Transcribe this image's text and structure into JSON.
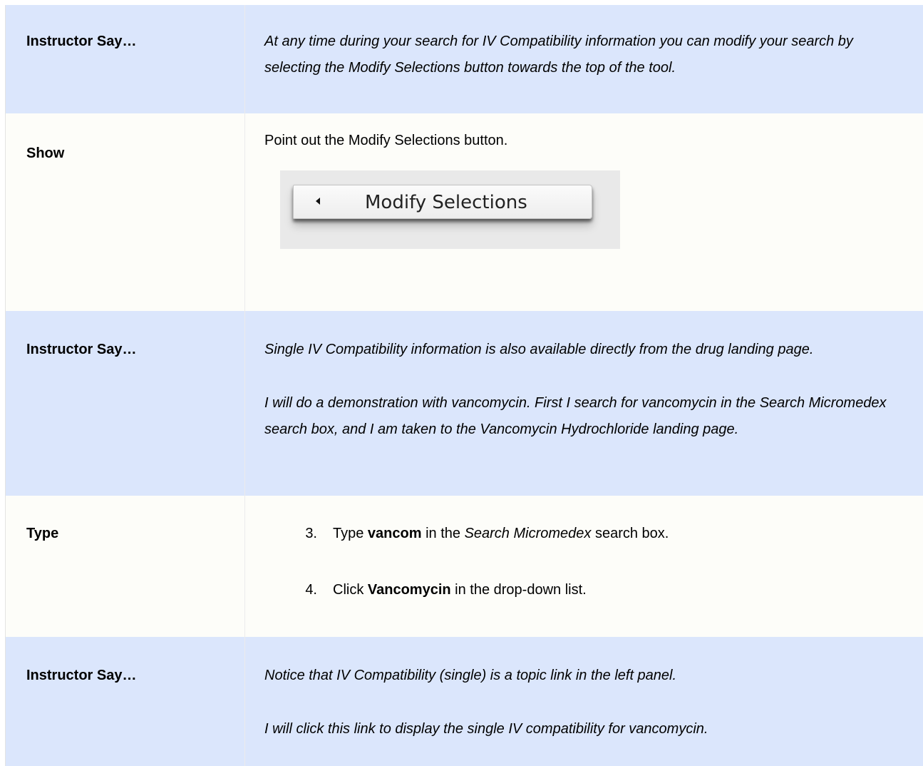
{
  "rows": [
    {
      "label": "Instructor Say…",
      "text": "At any time during your search for IV Compatibility information you can modify your search by selecting the Modify Selections button towards the top of the tool."
    },
    {
      "label": "Show",
      "text": "Point out the Modify Selections button.",
      "button_label": "Modify Selections"
    },
    {
      "label": "Instructor Say…",
      "para1": "Single IV Compatibility information is also available directly from the drug landing page.",
      "para2": "I will do a demonstration with vancomycin. First I search for vancomycin in the Search Micromedex search box, and I am taken to the Vancomycin Hydrochloride landing page."
    },
    {
      "label": "Type",
      "steps": [
        {
          "num": "3.",
          "pre": "Type ",
          "bold": "vancom",
          "mid": " in the ",
          "italic": "Search Micromedex",
          "post": " search box."
        },
        {
          "num": "4.",
          "pre": "Click ",
          "bold": "Vancomycin",
          "post": " in the drop-down list."
        }
      ]
    },
    {
      "label": "Instructor Say…",
      "para1": "Notice that IV Compatibility (single) is a topic link in the left panel.",
      "para2": "I will click this link to display the single IV compatibility for vancomycin."
    }
  ]
}
